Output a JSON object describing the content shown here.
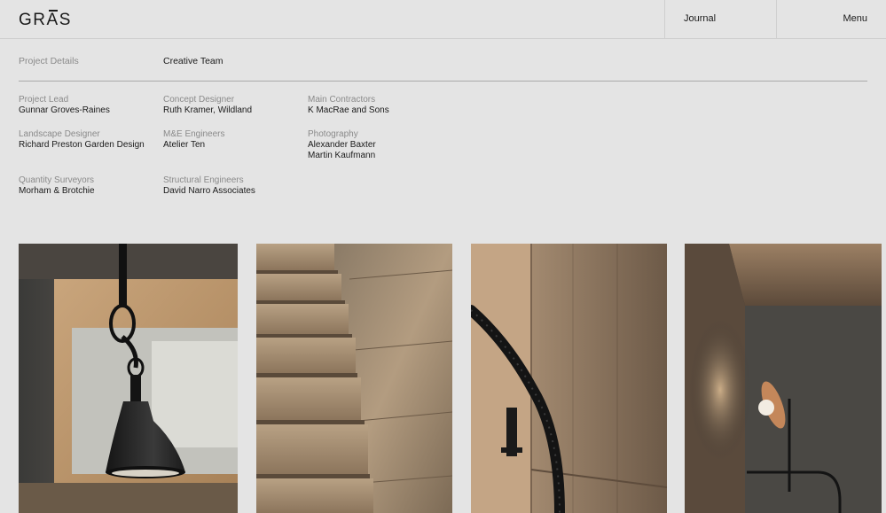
{
  "header": {
    "logo_prefix": "GR",
    "logo_accent": "A",
    "logo_suffix": "S",
    "journal_label": "Journal",
    "menu_label": "Menu"
  },
  "tabs": {
    "project_details": "Project Details",
    "creative_team": "Creative Team"
  },
  "credits": [
    {
      "role": "Project Lead",
      "names": [
        "Gunnar Groves-Raines"
      ]
    },
    {
      "role": "Concept Designer",
      "names": [
        "Ruth Kramer, Wildland"
      ]
    },
    {
      "role": "Main Contractors",
      "names": [
        "K MacRae and Sons"
      ]
    },
    {
      "role": "Landscape Designer",
      "names": [
        "Richard Preston Garden Design"
      ]
    },
    {
      "role": "M&E Engineers",
      "names": [
        "Atelier Ten"
      ]
    },
    {
      "role": "Photography",
      "names": [
        "Alexander Baxter",
        "Martin Kaufmann"
      ]
    },
    {
      "role": "Quantity Surveyors",
      "names": [
        "Morham & Brotchie"
      ]
    },
    {
      "role": "Structural Engineers",
      "names": [
        "David Narro Associates"
      ]
    }
  ],
  "colors": {
    "background": "#e4e4e4",
    "text": "#1a1a1a",
    "muted": "#8a8a8a",
    "rule": "#a9a9a9"
  },
  "gallery": [
    {
      "subject": "pendant-lamp"
    },
    {
      "subject": "oak-staircase"
    },
    {
      "subject": "stair-handrail"
    },
    {
      "subject": "wall-lamp"
    }
  ]
}
